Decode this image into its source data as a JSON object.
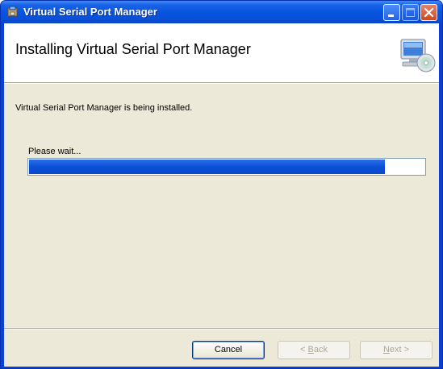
{
  "window": {
    "title": "Virtual Serial Port Manager",
    "icons": {
      "app": "installer-icon",
      "minimize": "minimize-icon",
      "maximize": "maximize-icon",
      "close": "close-icon"
    }
  },
  "banner": {
    "title": "Installing Virtual Serial Port Manager",
    "icon": "computer-cd-icon"
  },
  "body": {
    "status": "Virtual Serial Port Manager is being installed.",
    "wait_label": "Please wait...",
    "progress_fraction": 0.9
  },
  "buttons": {
    "cancel": "Cancel",
    "back_prefix": "< ",
    "back_mnemonic": "B",
    "back_rest": "ack",
    "next_mnemonic": "N",
    "next_rest": "ext >"
  },
  "colors": {
    "titlebar": "#0755e0",
    "progress": "#0b50d8",
    "dialog_bg": "#ece9d8"
  }
}
